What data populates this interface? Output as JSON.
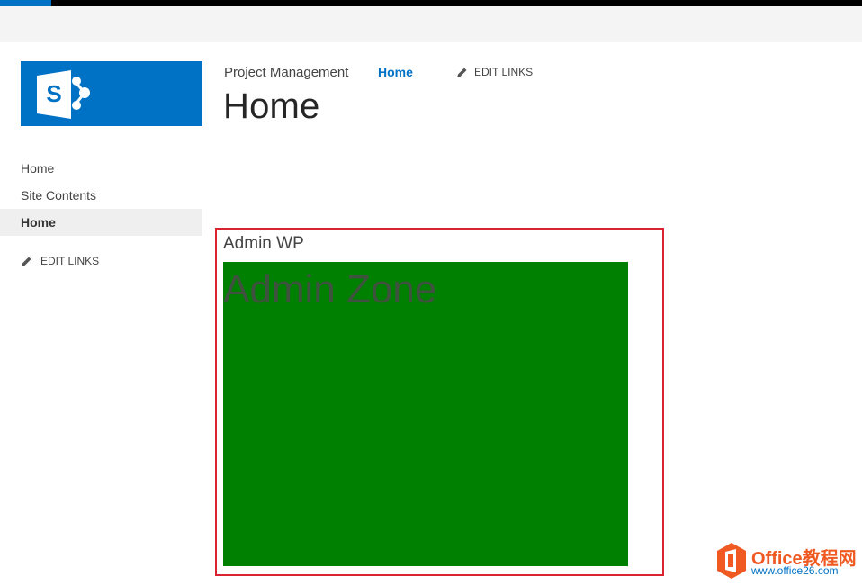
{
  "suite": {
    "accent_color": "#0072c6"
  },
  "logo": {
    "icon": "sharepoint-logo-icon",
    "color": "#0072c6"
  },
  "top_nav": {
    "site_link": "Project Management",
    "current_link": "Home",
    "edit_links": "EDIT LINKS"
  },
  "page": {
    "title": "Home"
  },
  "quick_launch": {
    "items": [
      {
        "label": "Home"
      },
      {
        "label": "Site Contents"
      },
      {
        "label": "Home",
        "selected": true
      }
    ],
    "edit_links": "EDIT LINKS"
  },
  "web_part": {
    "title": "Admin WP",
    "content": "Admin Zone",
    "background_color": "#008000",
    "highlight_color": "#d9232f"
  },
  "watermark": {
    "line1": "Office教程网",
    "line2": "www.office26.com",
    "icon": "office-logo-icon"
  }
}
